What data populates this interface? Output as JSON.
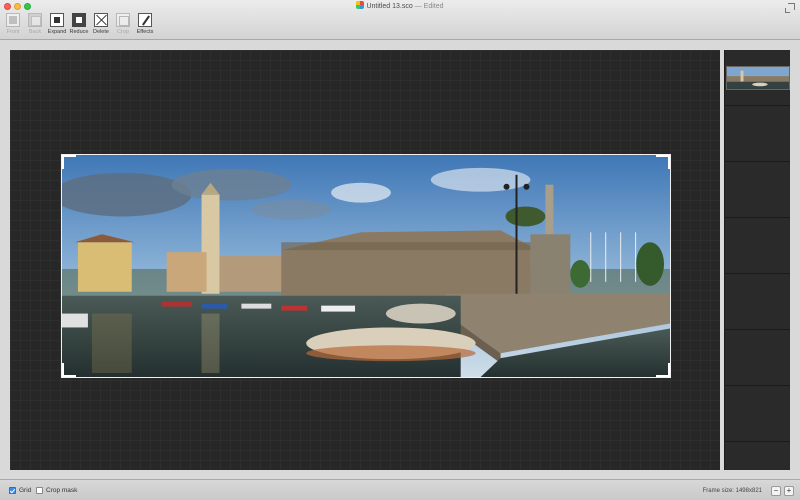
{
  "window": {
    "title": "Untitled 13.sco",
    "status": " — Edited"
  },
  "toolbar": {
    "items": [
      {
        "label": "Front",
        "icon": "bring-front-icon",
        "enabled": false
      },
      {
        "label": "Back",
        "icon": "send-back-icon",
        "enabled": false
      },
      {
        "label": "Expand",
        "icon": "expand-icon",
        "enabled": true
      },
      {
        "label": "Reduce",
        "icon": "reduce-icon",
        "enabled": true
      },
      {
        "label": "Delete",
        "icon": "delete-icon",
        "enabled": true
      },
      {
        "label": "Crop",
        "icon": "crop-icon",
        "enabled": false
      },
      {
        "label": "Effects",
        "icon": "effects-icon",
        "enabled": true
      }
    ]
  },
  "canvas": {
    "image": "panorama-harbor-photo",
    "background": "#272727"
  },
  "filmstrip": {
    "thumbnail": "panorama-harbor-thumbnail",
    "empty_slots": 6
  },
  "statusbar": {
    "grid_label": "Grid",
    "grid_checked": true,
    "crop_mask_label": "Crop mask",
    "crop_mask_checked": false,
    "frame_size": "Frame size: 1498x821",
    "zoom_out": "−",
    "zoom_in": "+"
  },
  "colors": {
    "accent": "#3d8ee8",
    "close": "#fc605b",
    "minimize": "#fdbc40",
    "maximize": "#34c84a"
  }
}
